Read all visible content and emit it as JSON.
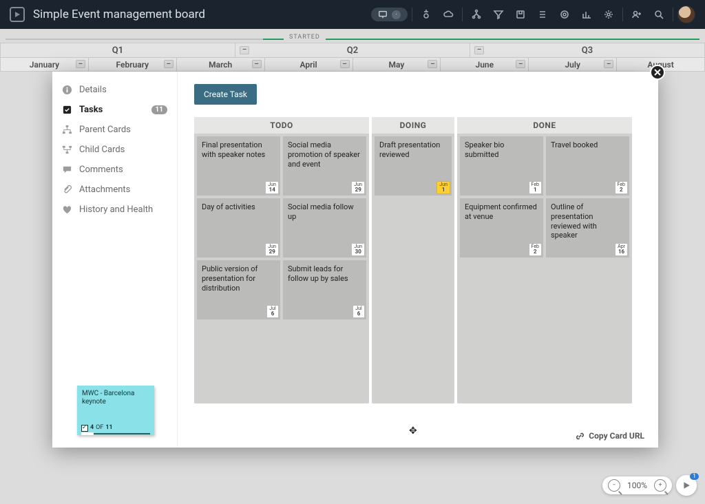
{
  "header": {
    "title": "Simple Event management board",
    "pill_badge": "·"
  },
  "timeline": {
    "started_label": "STARTED",
    "quarters": [
      "Q1",
      "Q2",
      "Q3"
    ],
    "months": [
      "January",
      "February",
      "March",
      "April",
      "May",
      "June",
      "July",
      "August"
    ]
  },
  "modal": {
    "sidebar": {
      "items": [
        {
          "label": "Details",
          "icon": "info"
        },
        {
          "label": "Tasks",
          "icon": "check",
          "count": "11",
          "active": true
        },
        {
          "label": "Parent Cards",
          "icon": "parent"
        },
        {
          "label": "Child Cards",
          "icon": "child"
        },
        {
          "label": "Comments",
          "icon": "comment"
        },
        {
          "label": "Attachments",
          "icon": "attach"
        },
        {
          "label": "History and Health",
          "icon": "heart"
        }
      ],
      "sticky": {
        "title": "MWC - Barcelona keynote",
        "done": "4",
        "of": "OF",
        "total": "11"
      }
    },
    "create_btn": "Create Task",
    "columns": {
      "todo": {
        "title": "TODO",
        "tasks": [
          {
            "t": "Final presentation with speaker notes",
            "dm": "Jun",
            "dd": "14"
          },
          {
            "t": "Social media promotion of speaker and event",
            "dm": "Jun",
            "dd": "29"
          },
          {
            "t": "Day of activities",
            "dm": "Jun",
            "dd": "29"
          },
          {
            "t": "Social media follow up",
            "dm": "Jun",
            "dd": "30"
          },
          {
            "t": "Public version of presentation for distribution",
            "dm": "Jul",
            "dd": "6"
          },
          {
            "t": "Submit leads for follow up by sales",
            "dm": "Jul",
            "dd": "6"
          }
        ]
      },
      "doing": {
        "title": "DOING",
        "tasks": [
          {
            "t": "Draft presentation reviewed",
            "dm": "Jun",
            "dd": "1",
            "hl": true
          }
        ]
      },
      "done": {
        "title": "DONE",
        "tasks": [
          {
            "t": "Speaker bio submitted",
            "dm": "Feb",
            "dd": "1"
          },
          {
            "t": "Travel booked",
            "dm": "Feb",
            "dd": "2"
          },
          {
            "t": "Equipment confirmed at venue",
            "dm": "Feb",
            "dd": "2"
          },
          {
            "t": "Outline of presentation reviewed with speaker",
            "dm": "Apr",
            "dd": "16"
          }
        ]
      }
    },
    "copy_url": "Copy Card URL"
  },
  "zoom": {
    "level": "100%",
    "badge": "1"
  }
}
